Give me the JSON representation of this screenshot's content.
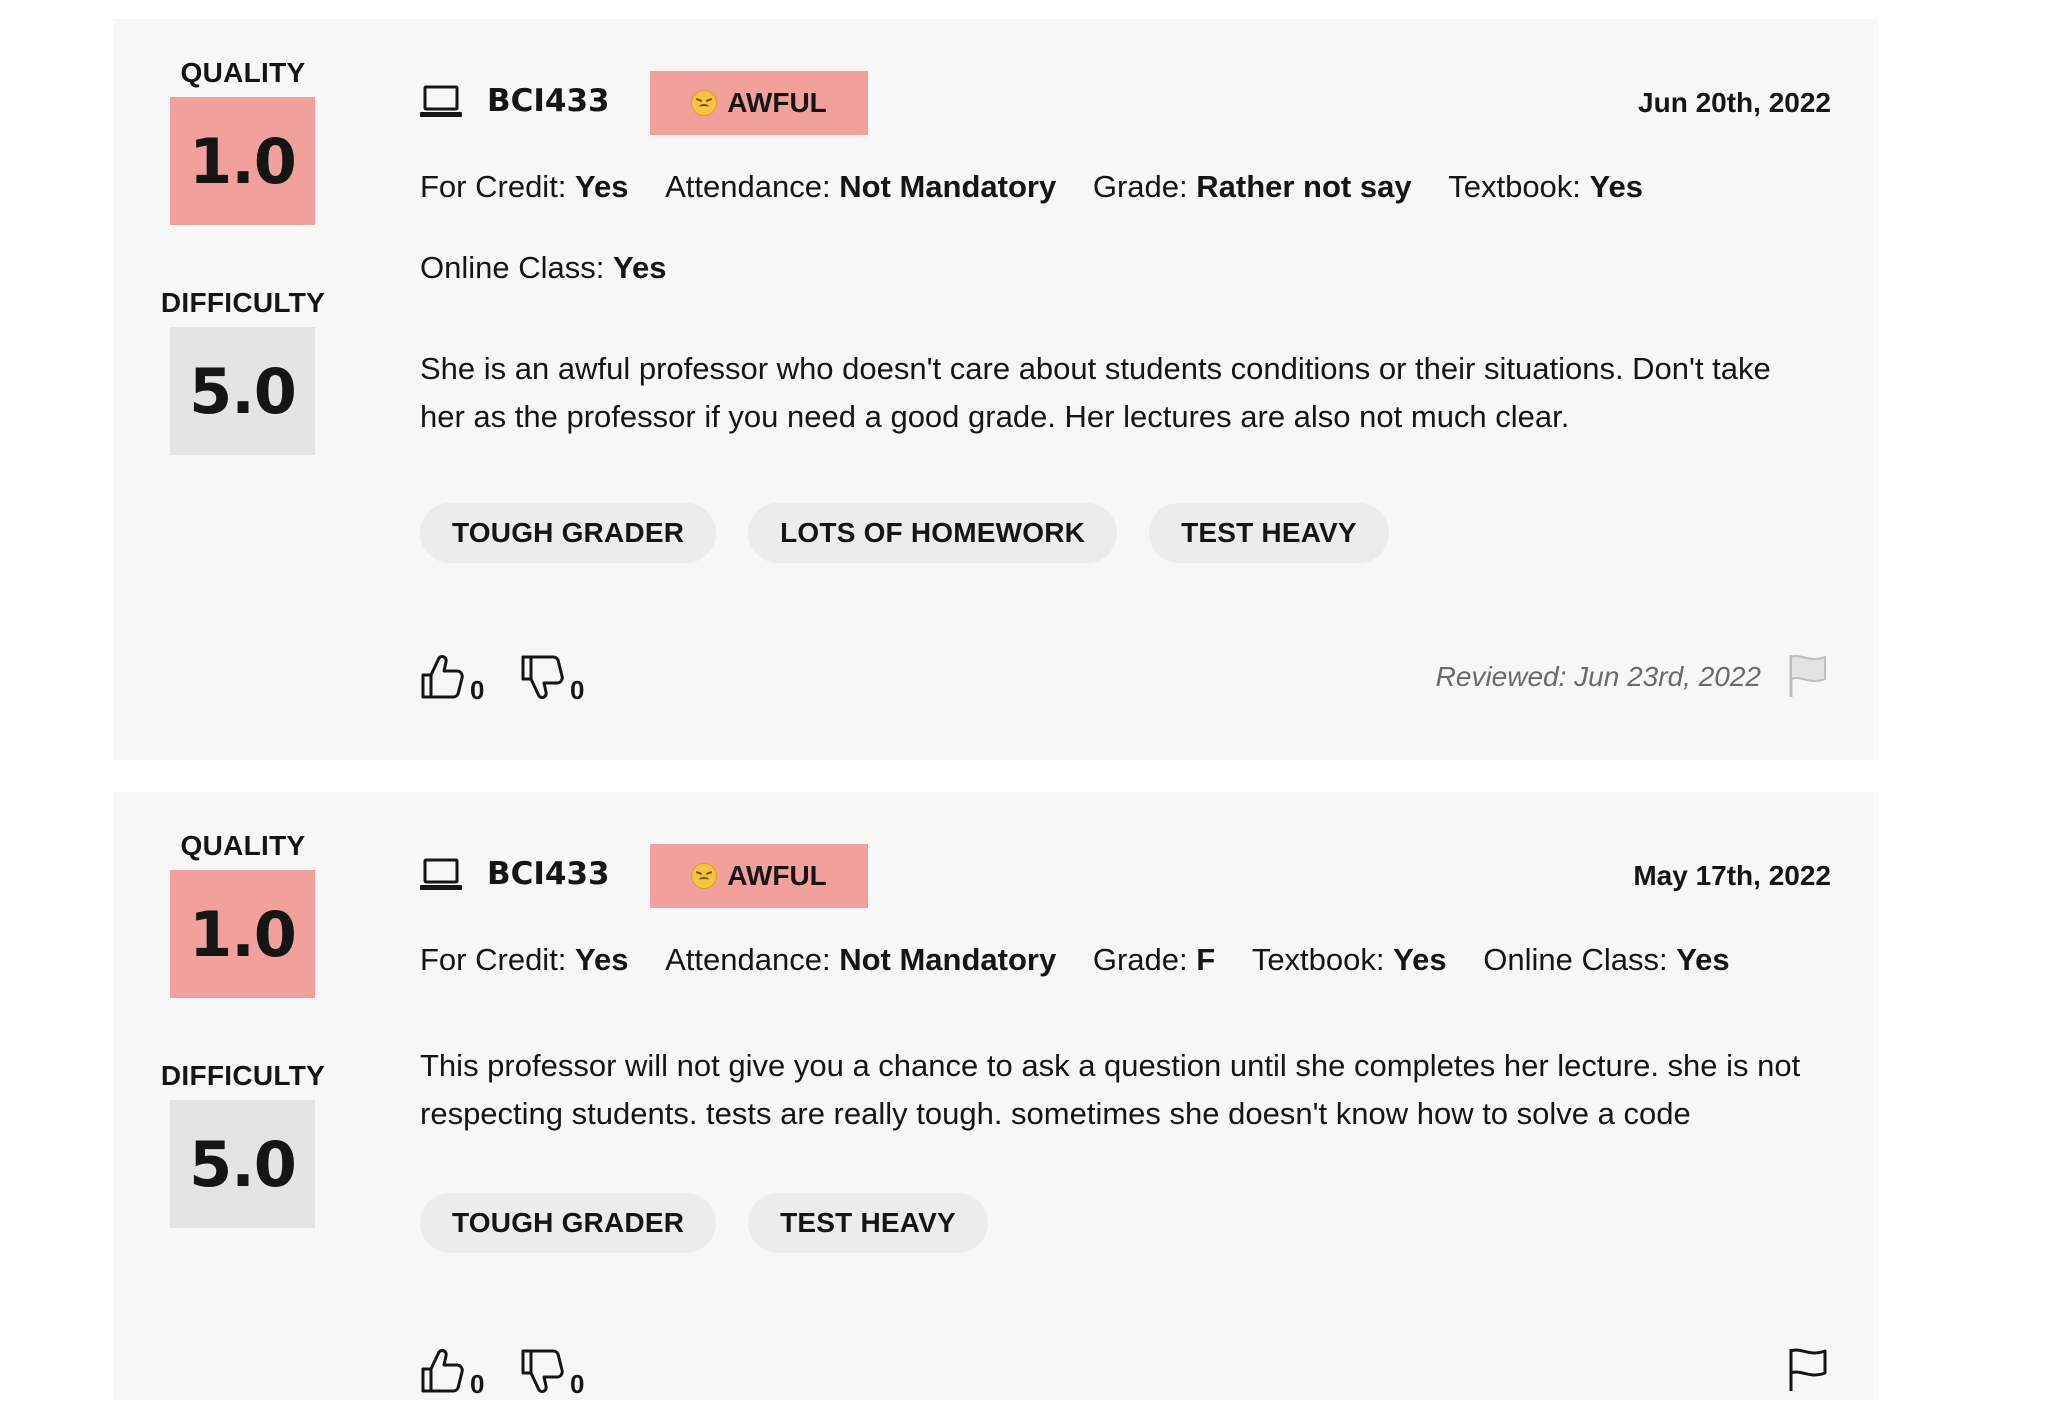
{
  "reviews": [
    {
      "quality_label": "QUALITY",
      "quality_score": "1.0",
      "difficulty_label": "DIFFICULTY",
      "difficulty_score": "5.0",
      "course": "BCI433",
      "emotion": "AWFUL",
      "date": "Jun 20th, 2022",
      "meta": {
        "for_credit_label": "For Credit:",
        "for_credit": "Yes",
        "attendance_label": "Attendance:",
        "attendance": "Not Mandatory",
        "grade_label": "Grade:",
        "grade": "Rather not say",
        "textbook_label": "Textbook:",
        "textbook": "Yes",
        "online_label": "Online Class:",
        "online": "Yes"
      },
      "comment": "She is an awful professor who doesn't care about students conditions or their situations. Don't take her as the professor if you need a good grade. Her lectures are also not much clear.",
      "tags": [
        "TOUGH GRADER",
        "LOTS OF HOMEWORK",
        "TEST HEAVY"
      ],
      "thumbs_up": "0",
      "thumbs_down": "0",
      "reviewed": "Reviewed: Jun 23rd, 2022"
    },
    {
      "quality_label": "QUALITY",
      "quality_score": "1.0",
      "difficulty_label": "DIFFICULTY",
      "difficulty_score": "5.0",
      "course": "BCI433",
      "emotion": "AWFUL",
      "date": "May 17th, 2022",
      "meta": {
        "for_credit_label": "For Credit:",
        "for_credit": "Yes",
        "attendance_label": "Attendance:",
        "attendance": "Not Mandatory",
        "grade_label": "Grade:",
        "grade": "F",
        "textbook_label": "Textbook:",
        "textbook": "Yes",
        "online_label": "Online Class:",
        "online": "Yes"
      },
      "comment": "This professor will not give you a chance to ask a question until she completes her lecture. she is not respecting students. tests are really tough. sometimes she doesn't know how to solve a code",
      "tags": [
        "TOUGH GRADER",
        "TEST HEAVY"
      ],
      "thumbs_up": "0",
      "thumbs_down": "0"
    }
  ],
  "icons": {
    "course": "laptop-icon",
    "emotion": "angry-face-icon",
    "helpful": "thumbs-up-icon",
    "not_helpful": "thumbs-down-icon",
    "report": "flag-icon"
  },
  "colors": {
    "quality_box": "#f2a09c",
    "difficulty_box": "#e4e4e4",
    "card_bg": "#f7f7f7",
    "tag_bg": "#ececec"
  }
}
